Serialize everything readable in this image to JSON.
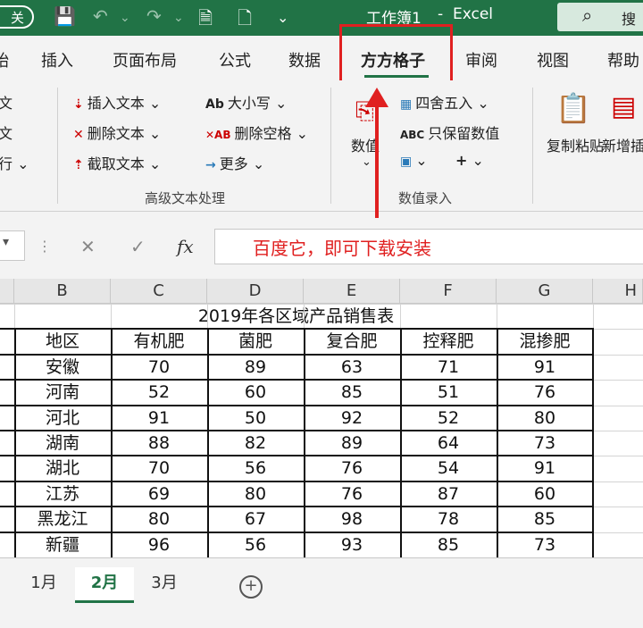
{
  "titlebar": {
    "autosave_label": "关",
    "doc_title": "工作簿1",
    "separator": "-",
    "app_name": "Excel",
    "search_label": "搜"
  },
  "tabs": [
    "始",
    "插入",
    "页面布局",
    "公式",
    "数据",
    "方方格子",
    "审阅",
    "视图",
    "帮助"
  ],
  "active_tab": "方方格子",
  "ribbon": {
    "left_cut": [
      "文",
      "文",
      "行 ⌄"
    ],
    "text_tools": {
      "insert_text": "插入文本 ⌄",
      "delete_text": "删除文本 ⌄",
      "extract_text": "截取文本 ⌄",
      "case": "大小写 ⌄",
      "delete_spaces": "删除空格 ⌄",
      "more": "更多 ⌄",
      "group_label": "高级文本处理"
    },
    "numeric": {
      "value_label": "数值",
      "round": "四舍五入 ⌄",
      "keep_values": "只保留数值",
      "group_label": "数值录入"
    },
    "copy_paste": "复制粘贴",
    "new_insert": "新增插入"
  },
  "formula_bar": {
    "fx_label": "fx",
    "annotation": "百度它，即可下载安装"
  },
  "columns": [
    "B",
    "C",
    "D",
    "E",
    "F",
    "G",
    "H"
  ],
  "table": {
    "title": "2019年各区域产品销售表",
    "headers": [
      "地区",
      "有机肥",
      "菌肥",
      "复合肥",
      "控释肥",
      "混掺肥"
    ],
    "rows": [
      [
        "安徽",
        "70",
        "89",
        "63",
        "71",
        "91"
      ],
      [
        "河南",
        "52",
        "60",
        "85",
        "51",
        "76"
      ],
      [
        "河北",
        "91",
        "50",
        "92",
        "52",
        "80"
      ],
      [
        "湖南",
        "88",
        "82",
        "89",
        "64",
        "73"
      ],
      [
        "湖北",
        "70",
        "56",
        "76",
        "54",
        "91"
      ],
      [
        "江苏",
        "69",
        "80",
        "76",
        "87",
        "60"
      ],
      [
        "黑龙江",
        "80",
        "67",
        "98",
        "78",
        "85"
      ],
      [
        "新疆",
        "96",
        "56",
        "93",
        "85",
        "73"
      ]
    ]
  },
  "sheet_tabs": [
    "1月",
    "2月",
    "3月"
  ],
  "active_sheet": "2月",
  "colors": {
    "accent": "#217346",
    "annotation": "#e02020"
  }
}
